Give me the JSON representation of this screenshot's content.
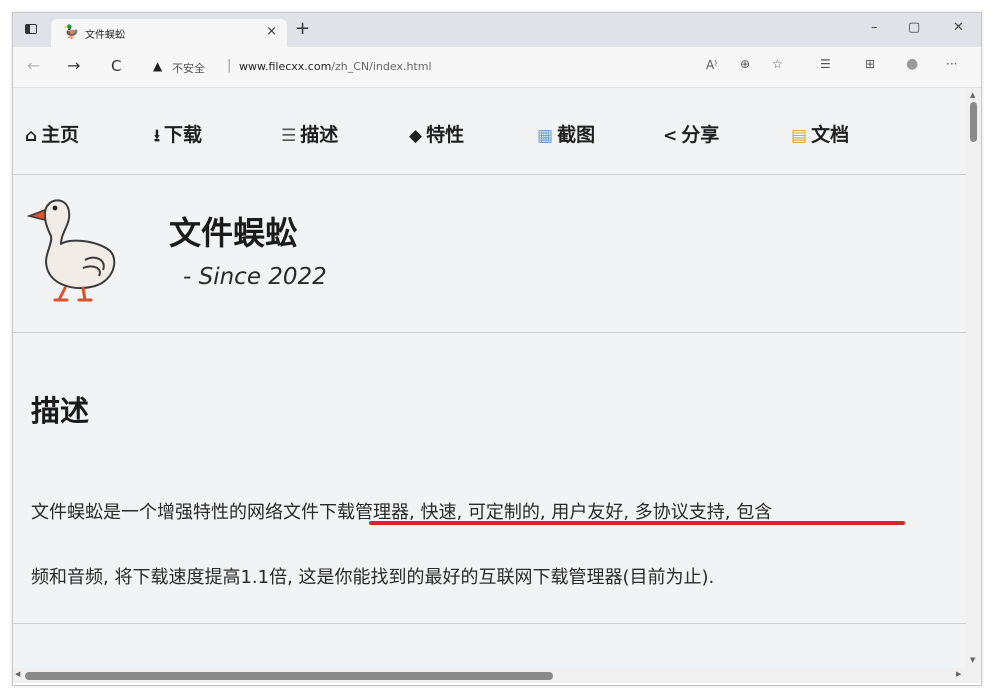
{
  "browser": {
    "tab_title": "文件蜈蚣",
    "tab_close": "×",
    "new_tab": "+",
    "window_controls": {
      "minimize": "–",
      "maximize": "▢",
      "close": "✕"
    },
    "nav": {
      "back": "←",
      "forward": "→",
      "refresh": "C"
    },
    "security_label": "不安全",
    "separator": "|",
    "url_domain": "www.filecxx.com",
    "url_path": "/zh_CN/index.html",
    "toolbar_icons": {
      "read_aloud": "A⁾",
      "zoom": "⊕",
      "favorites": "☆",
      "collections": "☰",
      "extensions": "⊞",
      "profile": "●",
      "more": "···"
    }
  },
  "site": {
    "nav_items": [
      {
        "icon": "⌂",
        "label": "主页"
      },
      {
        "icon": "⭳",
        "label": "下载"
      },
      {
        "icon": "☰",
        "label": "描述"
      },
      {
        "icon": "◆",
        "label": "特性"
      },
      {
        "icon": "▦",
        "label": "截图"
      },
      {
        "icon": "<",
        "label": "分享"
      },
      {
        "icon": "▤",
        "label": "文档"
      }
    ],
    "title": "文件蜈蚣",
    "since": "- Since 2022",
    "section_heading": "描述",
    "description_line1": "文件蜈蚣是一个增强特性的网络文件下载管理器, 快速, 可定制的, 用户友好, 多协议支持, 包含",
    "description_line2_start": "频和音频, 将下载速度提高1.1倍, ",
    "description_line2_highlight": "这是你能找到的最好的互联网下载管理器(目前为止)."
  },
  "colors": {
    "page_bg": "#f2f3f5",
    "underline": "#d62828",
    "tabstrip": "#dfe3e8"
  }
}
